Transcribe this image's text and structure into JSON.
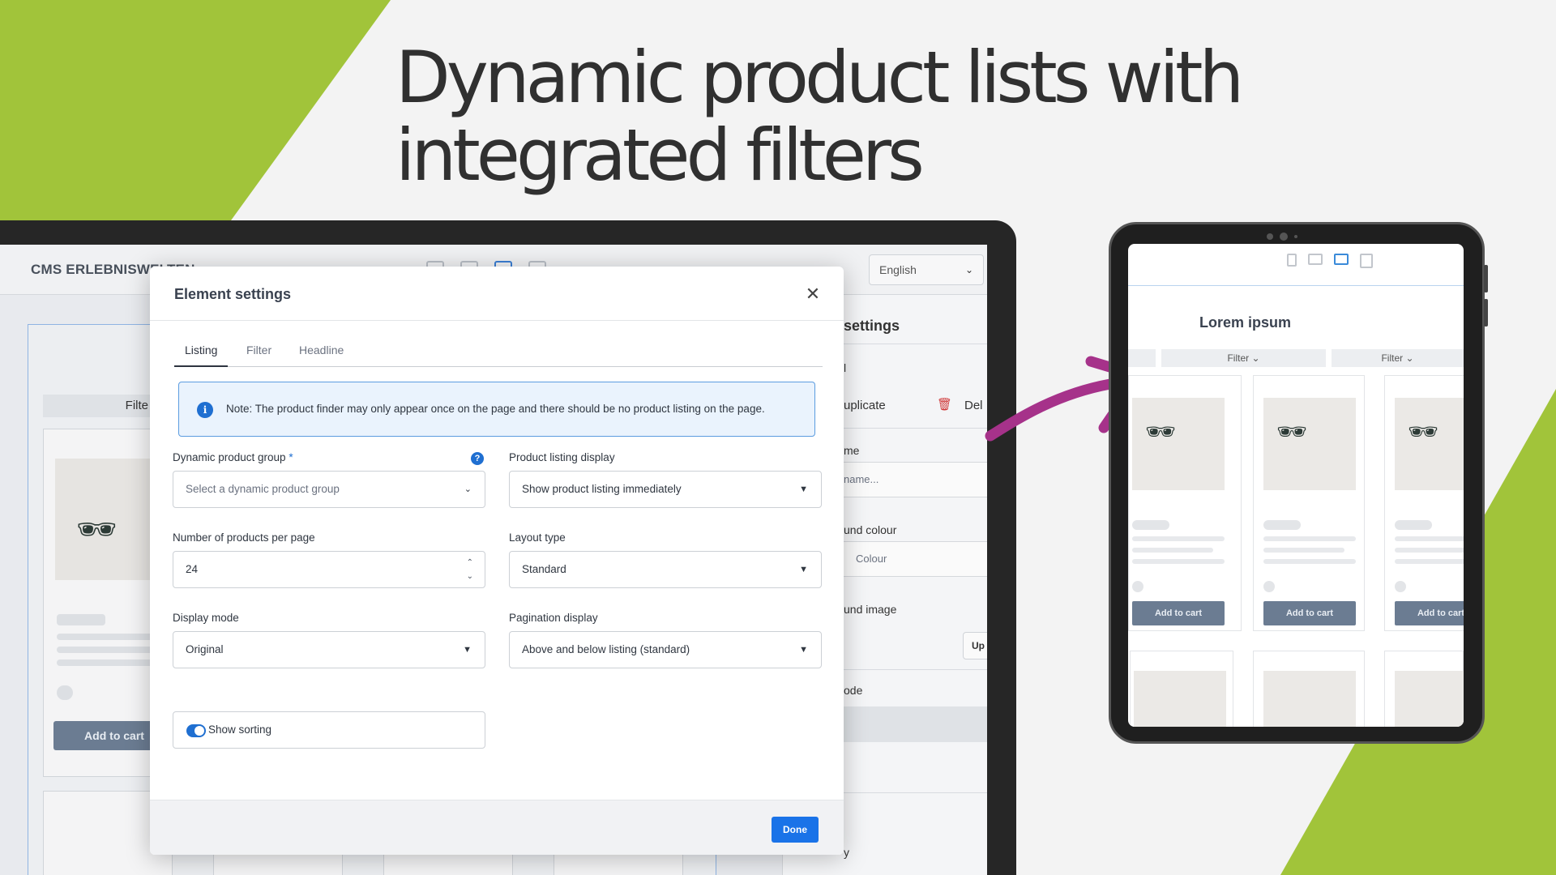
{
  "headline": {
    "line1": "Dynamic product lists with",
    "line2": "integrated filters"
  },
  "admin": {
    "title": "CMS ERLEBNISWELTEN",
    "language": "English",
    "canvas_filter": "Filte",
    "add_to_cart": "Add to cart",
    "right_panel": {
      "title": "settings",
      "duplicate": "uplicate",
      "delete": "Del",
      "name_label": "me",
      "name_placeholder": "name...",
      "bg_colour_label": "und colour",
      "colour_placeholder": "Colour",
      "bg_image_label": "und image",
      "upload_btn": "Up",
      "mode_label": "ode",
      "extra_label": "y",
      "partial_label": "l"
    }
  },
  "modal": {
    "title": "Element settings",
    "tabs": [
      "Listing",
      "Filter",
      "Headline"
    ],
    "notice": "Note: The product finder may only appear once on the page and there should be no product listing on the page.",
    "fields": {
      "dynamic_group": {
        "label": "Dynamic product group",
        "required": "*",
        "placeholder": "Select a dynamic product group"
      },
      "listing_display": {
        "label": "Product listing display",
        "value": "Show product listing immediately"
      },
      "per_page": {
        "label": "Number of products per page",
        "value": "24"
      },
      "layout_type": {
        "label": "Layout type",
        "value": "Standard"
      },
      "display_mode": {
        "label": "Display mode",
        "value": "Original"
      },
      "pagination": {
        "label": "Pagination display",
        "value": "Above and below listing (standard)"
      }
    },
    "show_sorting": {
      "label": "Show sorting",
      "enabled": true
    },
    "done": "Done"
  },
  "tablet": {
    "heading": "Lorem ipsum",
    "filter_label": "Filter",
    "add_to_cart": "Add to cart"
  },
  "colors": {
    "accent_green": "#a1c43a",
    "primary_blue": "#1a73e8",
    "arrow_magenta": "#a6328a",
    "cart_button": "#6b7c92"
  }
}
